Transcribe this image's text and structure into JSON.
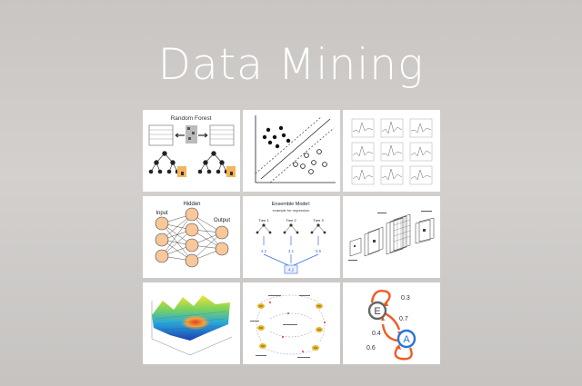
{
  "page": {
    "title": "Data Mining"
  },
  "tiles": [
    {
      "name": "random-forest",
      "caption": "Random Forest"
    },
    {
      "name": "svm-scatter",
      "caption": ""
    },
    {
      "name": "line-plots-grid",
      "caption": ""
    },
    {
      "name": "neural-network",
      "labels": {
        "input": "Input",
        "hidden": "Hidden",
        "output": "Output"
      }
    },
    {
      "name": "ensemble-model",
      "title": "Ensemble Model:",
      "subtitle": "example for regression",
      "trees": [
        "Tree 1",
        "Tree 2",
        "Tree 3"
      ],
      "values": [
        "4.2",
        "3.1",
        "0.5"
      ],
      "result": "4.2"
    },
    {
      "name": "cnn-diagram",
      "caption": ""
    },
    {
      "name": "3d-surface-plot",
      "caption": ""
    },
    {
      "name": "bee-flow-diagram",
      "caption": ""
    },
    {
      "name": "markov-chain",
      "states": [
        "E",
        "A"
      ],
      "probabilities": [
        "0.3",
        "0.7",
        "0.4",
        "0.6"
      ]
    }
  ]
}
